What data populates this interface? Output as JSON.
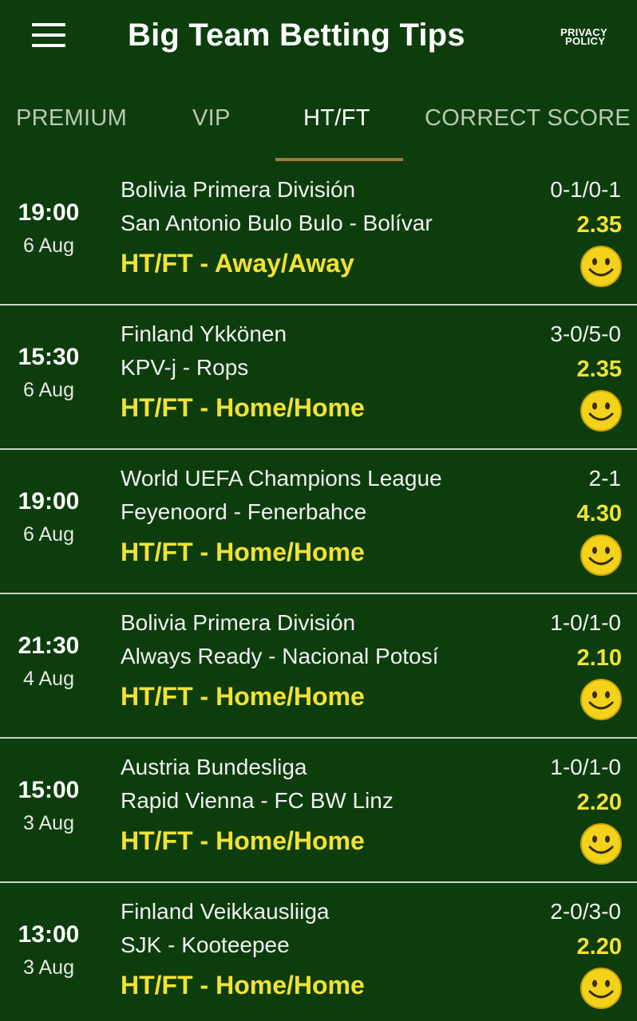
{
  "header": {
    "title": "Big Team Betting Tips",
    "privacy_line1": "PRIVACY",
    "privacy_line2": "POLICY"
  },
  "tabs": [
    {
      "label": "PREMIUM",
      "active": false
    },
    {
      "label": "VIP",
      "active": false
    },
    {
      "label": "HT/FT",
      "active": true
    },
    {
      "label": "CORRECT SCORE",
      "active": false
    }
  ],
  "colors": {
    "background": "#0d3d0d",
    "tip_yellow": "#f2e233",
    "tab_underline": "#a07a3c",
    "smiley_face": "#f2d21b"
  },
  "tips": [
    {
      "time": "19:00",
      "date": "6 Aug",
      "league": "Bolivia Primera División",
      "teams": "San Antonio Bulo Bulo - Bolívar",
      "tip": "HT/FT - Away/Away",
      "score": "0-1/0-1",
      "odds": "2.35",
      "result_icon": "smiley-icon"
    },
    {
      "time": "15:30",
      "date": "6 Aug",
      "league": "Finland Ykkönen",
      "teams": "KPV-j - Rops",
      "tip": "HT/FT - Home/Home",
      "score": "3-0/5-0",
      "odds": "2.35",
      "result_icon": "smiley-icon"
    },
    {
      "time": "19:00",
      "date": "6 Aug",
      "league": "World UEFA Champions League",
      "teams": "Feyenoord - Fenerbahce",
      "tip": "HT/FT - Home/Home",
      "score": "2-1",
      "odds": "4.30",
      "result_icon": "smiley-icon"
    },
    {
      "time": "21:30",
      "date": "4 Aug",
      "league": "Bolivia Primera División",
      "teams": "Always Ready - Nacional Potosí",
      "tip": "HT/FT - Home/Home",
      "score": "1-0/1-0",
      "odds": "2.10",
      "result_icon": "smiley-icon"
    },
    {
      "time": "15:00",
      "date": "3 Aug",
      "league": "Austria Bundesliga",
      "teams": "Rapid Vienna - FC BW Linz",
      "tip": "HT/FT - Home/Home",
      "score": "1-0/1-0",
      "odds": "2.20",
      "result_icon": "smiley-icon"
    },
    {
      "time": "13:00",
      "date": "3 Aug",
      "league": "Finland Veikkausliiga",
      "teams": "SJK - Kooteepee",
      "tip": "HT/FT - Home/Home",
      "score": "2-0/3-0",
      "odds": "2.20",
      "result_icon": "smiley-icon"
    }
  ]
}
